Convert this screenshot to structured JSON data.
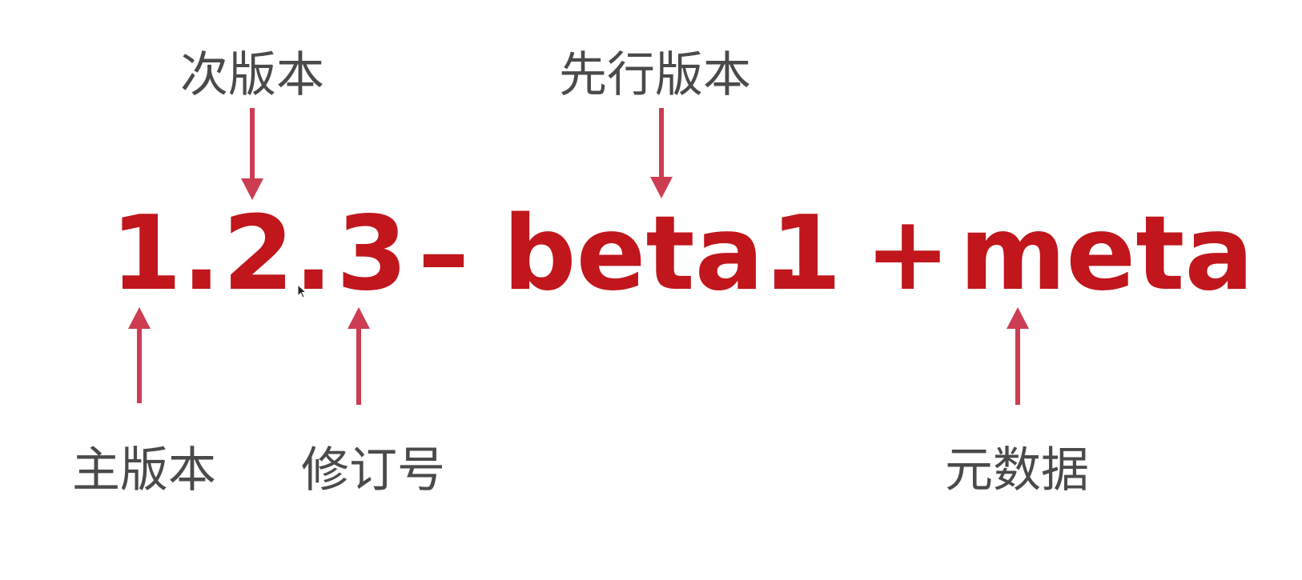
{
  "version_string": {
    "parts": [
      "1.",
      "2.",
      "3",
      "–",
      "beta.",
      "1",
      "+",
      "meta"
    ],
    "color": "#c0161c"
  },
  "labels": {
    "minor": "次版本",
    "prerelease": "先行版本",
    "major": "主版本",
    "patch": "修订号",
    "metadata": "元数据",
    "color": "#4a4a4a"
  },
  "arrows": {
    "color": "#cc3d52",
    "down": [
      "minor",
      "prerelease"
    ],
    "up": [
      "major",
      "patch",
      "metadata"
    ]
  }
}
